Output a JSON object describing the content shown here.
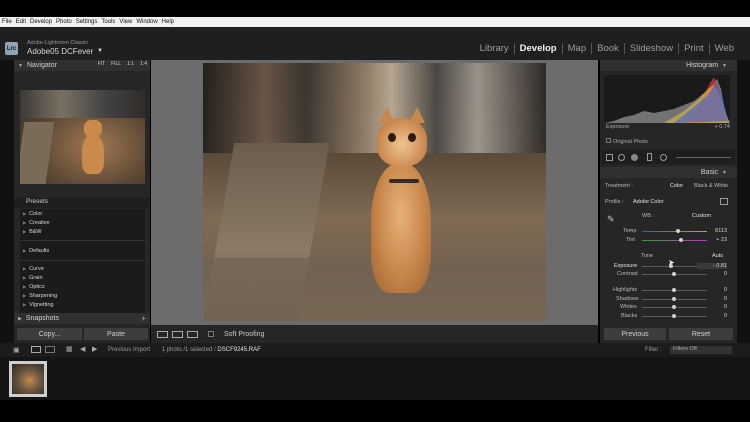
{
  "menubar": [
    "File",
    "Edit",
    "Develop",
    "Photo",
    "Settings",
    "Tools",
    "View",
    "Window",
    "Help"
  ],
  "identity": {
    "logo": "Lrc",
    "app_name": "Adobe Lightroom Classic",
    "catalog": "Adobe05 DCFever",
    "caret": "▼"
  },
  "modules": [
    {
      "label": "Library",
      "active": false
    },
    {
      "label": "Develop",
      "active": true
    },
    {
      "label": "Map",
      "active": false
    },
    {
      "label": "Book",
      "active": false
    },
    {
      "label": "Slideshow",
      "active": false
    },
    {
      "label": "Print",
      "active": false
    },
    {
      "label": "Web",
      "active": false
    }
  ],
  "left": {
    "navigator": "Navigator",
    "zoom": [
      "FIT",
      "FILL",
      "1:1",
      "1:4"
    ],
    "presets": "Presets",
    "preset_items": [
      "Color",
      "Creative",
      "B&W",
      "Defaults",
      "Curve",
      "Grain",
      "Optics",
      "Sharpening",
      "Vignetting"
    ],
    "snapshots": "Snapshots",
    "copy": "Copy...",
    "paste": "Paste"
  },
  "center": {
    "soft_proofing": "Soft Proofing"
  },
  "right": {
    "histogram": "Histogram",
    "exposure_label": "Exposure",
    "exposure_value": "+ 0.74",
    "original_photo": "Original Photo",
    "basic": "Basic",
    "treatment_label": "Treatment :",
    "treatment_color": "Color",
    "treatment_bw": "Black & White",
    "profile_label": "Profile :",
    "profile_value": "Adobe Color",
    "wb_label": "WB :",
    "wb_value": "Custom",
    "temp_label": "Temp",
    "temp_value": "8113",
    "tint_label": "Tint",
    "tint_value": "+ 23",
    "tone_label": "Tone",
    "tone_auto": "Auto",
    "sliders": [
      {
        "label": "Exposure",
        "value": "- 0.81"
      },
      {
        "label": "Contrast",
        "value": "0"
      },
      {
        "label": "Highlights",
        "value": "0"
      },
      {
        "label": "Shadows",
        "value": "0"
      },
      {
        "label": "Whites",
        "value": "0"
      },
      {
        "label": "Blacks",
        "value": "0"
      }
    ],
    "previous": "Previous",
    "reset": "Reset"
  },
  "filmbar": {
    "prev_import": "Previous Import",
    "photo_count": "1 photo /1 selected /",
    "filename": "DSCF9245.RAF",
    "filter_label": "Filter :",
    "filter_value": "Filters Off"
  },
  "colors": {
    "accent": "#f2f2f2",
    "panel": "#262626",
    "center_bg": "#6c6c6c"
  }
}
